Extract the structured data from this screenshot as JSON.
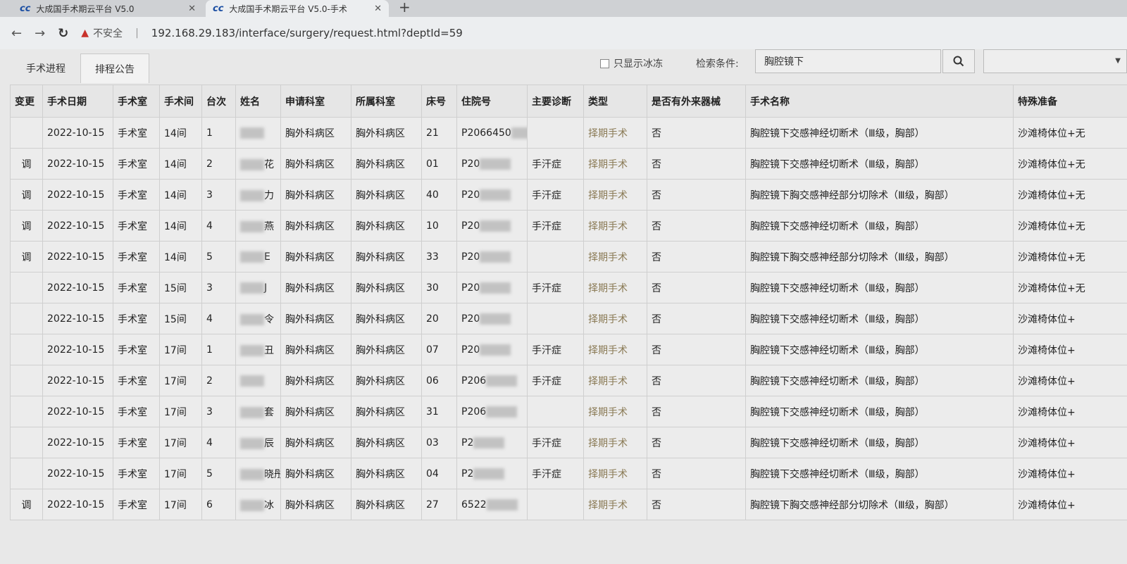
{
  "browser": {
    "tabs": [
      {
        "title": "大成国手术期云平台 V5.0"
      },
      {
        "title": "大成国手术期云平台 V5.0-手术"
      }
    ],
    "security": "不安全",
    "url": "192.168.29.183/interface/surgery/request.html?deptId=59"
  },
  "page": {
    "subtabs": [
      "手术进程",
      "排程公告"
    ],
    "active_subtab": 1,
    "filter_label": "只显示冰冻",
    "search_label": "检索条件:",
    "search_value": "胸腔镜下"
  },
  "table": {
    "headers": [
      "变更",
      "手术日期",
      "手术室",
      "手术间",
      "台次",
      "姓名",
      "申请科室",
      "所属科室",
      "床号",
      "住院号",
      "主要诊断",
      "类型",
      "是否有外来器械",
      "手术名称",
      "特殊准备"
    ],
    "rows": [
      [
        "",
        "2022-10-15",
        "手术室",
        "14间",
        "1",
        "",
        "胸外科病区",
        "胸外科病区",
        "21",
        "P2066450",
        "",
        "择期手术",
        "否",
        "胸腔镜下交感神经切断术（Ⅲ级，胸部）",
        "沙滩椅体位+无"
      ],
      [
        "调",
        "2022-10-15",
        "手术室",
        "14间",
        "2",
        "花",
        "胸外科病区",
        "胸外科病区",
        "01",
        "P20",
        "手汗症",
        "择期手术",
        "否",
        "胸腔镜下交感神经切断术（Ⅲ级，胸部）",
        "沙滩椅体位+无"
      ],
      [
        "调",
        "2022-10-15",
        "手术室",
        "14间",
        "3",
        "力",
        "胸外科病区",
        "胸外科病区",
        "40",
        "P20",
        "手汗症",
        "择期手术",
        "否",
        "胸腔镜下胸交感神经部分切除术（Ⅲ级，胸部）",
        "沙滩椅体位+无"
      ],
      [
        "调",
        "2022-10-15",
        "手术室",
        "14间",
        "4",
        "燕",
        "胸外科病区",
        "胸外科病区",
        "10",
        "P20",
        "手汗症",
        "择期手术",
        "否",
        "胸腔镜下交感神经切断术（Ⅲ级，胸部）",
        "沙滩椅体位+无"
      ],
      [
        "调",
        "2022-10-15",
        "手术室",
        "14间",
        "5",
        "E",
        "胸外科病区",
        "胸外科病区",
        "33",
        "P20",
        "",
        "择期手术",
        "否",
        "胸腔镜下胸交感神经部分切除术（Ⅲ级，胸部）",
        "沙滩椅体位+无"
      ],
      [
        "",
        "2022-10-15",
        "手术室",
        "15间",
        "3",
        "J",
        "胸外科病区",
        "胸外科病区",
        "30",
        "P20",
        "手汗症",
        "择期手术",
        "否",
        "胸腔镜下交感神经切断术（Ⅲ级，胸部）",
        "沙滩椅体位+无"
      ],
      [
        "",
        "2022-10-15",
        "手术室",
        "15间",
        "4",
        "令",
        "胸外科病区",
        "胸外科病区",
        "20",
        "P20",
        "",
        "择期手术",
        "否",
        "胸腔镜下交感神经切断术（Ⅲ级，胸部）",
        "沙滩椅体位+"
      ],
      [
        "",
        "2022-10-15",
        "手术室",
        "17间",
        "1",
        "丑",
        "胸外科病区",
        "胸外科病区",
        "07",
        "P20",
        "手汗症",
        "择期手术",
        "否",
        "胸腔镜下交感神经切断术（Ⅲ级，胸部）",
        "沙滩椅体位+"
      ],
      [
        "",
        "2022-10-15",
        "手术室",
        "17间",
        "2",
        "",
        "胸外科病区",
        "胸外科病区",
        "06",
        "P206",
        "手汗症",
        "择期手术",
        "否",
        "胸腔镜下交感神经切断术（Ⅲ级，胸部）",
        "沙滩椅体位+"
      ],
      [
        "",
        "2022-10-15",
        "手术室",
        "17间",
        "3",
        "套",
        "胸外科病区",
        "胸外科病区",
        "31",
        "P206",
        "",
        "择期手术",
        "否",
        "胸腔镜下交感神经切断术（Ⅲ级，胸部）",
        "沙滩椅体位+"
      ],
      [
        "",
        "2022-10-15",
        "手术室",
        "17间",
        "4",
        "辰",
        "胸外科病区",
        "胸外科病区",
        "03",
        "P2",
        "手汗症",
        "择期手术",
        "否",
        "胸腔镜下交感神经切断术（Ⅲ级，胸部）",
        "沙滩椅体位+"
      ],
      [
        "",
        "2022-10-15",
        "手术室",
        "17间",
        "5",
        "晓彤",
        "胸外科病区",
        "胸外科病区",
        "04",
        "P2",
        "手汗症",
        "择期手术",
        "否",
        "胸腔镜下交感神经切断术（Ⅲ级，胸部）",
        "沙滩椅体位+"
      ],
      [
        "调",
        "2022-10-15",
        "手术室",
        "17间",
        "6",
        "冰",
        "胸外科病区",
        "胸外科病区",
        "27",
        "6522",
        "",
        "择期手术",
        "否",
        "胸腔镜下胸交感神经部分切除术（Ⅲ级，胸部）",
        "沙滩椅体位+"
      ]
    ]
  }
}
